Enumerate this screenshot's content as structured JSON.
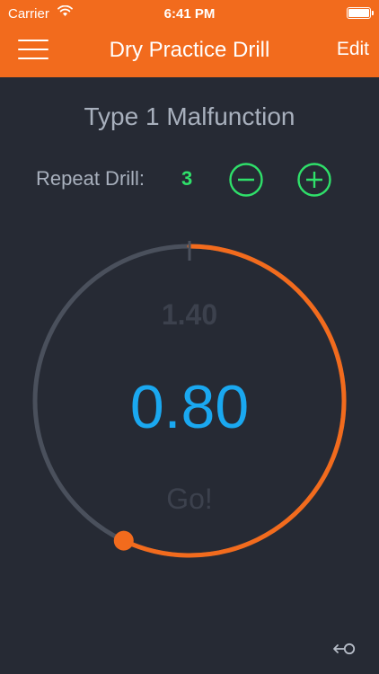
{
  "status_bar": {
    "carrier": "Carrier",
    "time": "6:41 PM"
  },
  "nav": {
    "title": "Dry Practice Drill",
    "edit_label": "Edit"
  },
  "drill": {
    "name": "Type 1 Malfunction",
    "repeat_label": "Repeat Drill:",
    "repeat_count": "3"
  },
  "timer": {
    "par_time": "1.40",
    "elapsed": "0.80",
    "status": "Go!",
    "progress_fraction": 0.57
  },
  "colors": {
    "accent": "#f26b1d",
    "timer_blue": "#1aa8f0",
    "count_green": "#2fe06a",
    "ring_gray": "#4a505c",
    "background": "#262a34"
  },
  "icons": {
    "menu": "hamburger-menu-icon",
    "minus": "minus-circle-icon",
    "plus": "plus-circle-icon",
    "back": "back-arrow-icon"
  }
}
